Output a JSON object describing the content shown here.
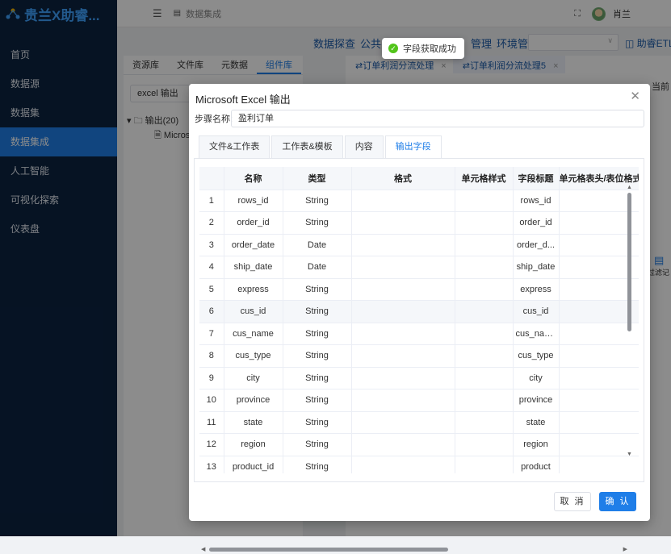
{
  "app": {
    "title": "贵兰X助睿..."
  },
  "sidebar": {
    "items": [
      {
        "label": "首页"
      },
      {
        "label": "数据源"
      },
      {
        "label": "数据集"
      },
      {
        "label": "数据集成",
        "active": true
      },
      {
        "label": "人工智能"
      },
      {
        "label": "可视化探索"
      },
      {
        "label": "仪表盘"
      }
    ]
  },
  "header": {
    "breadcrumb": "数据集成",
    "user": "肖兰"
  },
  "topmenu": {
    "items": [
      "数据探查",
      "公共字",
      "管理",
      "环境管理"
    ],
    "etl": "助睿ETL"
  },
  "left_panel": {
    "tabs": [
      "资源库",
      "文件库",
      "元数据",
      "组件库"
    ],
    "search_value": "excel 输出",
    "tree": {
      "node": "输出(20)",
      "child": "Micros"
    }
  },
  "right_panel": {
    "tabs": [
      "订单利润分流处理",
      "订单利润分流处理5"
    ],
    "side_note": "过滤记",
    "toolbar_label": "当前"
  },
  "toast": {
    "message": "字段获取成功"
  },
  "dialog": {
    "title": "Microsoft Excel 输出",
    "step_label": "步骤名称:",
    "step_value": "盈利订单",
    "tabs": [
      "文件&工作表",
      "工作表&模板",
      "内容",
      "输出字段"
    ],
    "active_tab": 3,
    "columns": [
      "",
      "名称",
      "类型",
      "格式",
      "单元格样式",
      "字段标题",
      "单元格表头/表位格式"
    ],
    "rows": [
      [
        "1",
        "rows_id",
        "String",
        "",
        "",
        "rows_id",
        ""
      ],
      [
        "2",
        "order_id",
        "String",
        "",
        "",
        "order_id",
        ""
      ],
      [
        "3",
        "order_date",
        "Date",
        "",
        "",
        "order_d...",
        ""
      ],
      [
        "4",
        "ship_date",
        "Date",
        "",
        "",
        "ship_date",
        ""
      ],
      [
        "5",
        "express",
        "String",
        "",
        "",
        "express",
        ""
      ],
      [
        "6",
        "cus_id",
        "String",
        "",
        "",
        "cus_id",
        ""
      ],
      [
        "7",
        "cus_name",
        "String",
        "",
        "",
        "cus_name",
        ""
      ],
      [
        "8",
        "cus_type",
        "String",
        "",
        "",
        "cus_type",
        ""
      ],
      [
        "9",
        "city",
        "String",
        "",
        "",
        "city",
        ""
      ],
      [
        "10",
        "province",
        "String",
        "",
        "",
        "province",
        ""
      ],
      [
        "11",
        "state",
        "String",
        "",
        "",
        "state",
        ""
      ],
      [
        "12",
        "region",
        "String",
        "",
        "",
        "region",
        ""
      ],
      [
        "13",
        "product_id",
        "String",
        "",
        "",
        "product",
        ""
      ]
    ],
    "highlight_row": 6,
    "cancel_label": "取 消",
    "ok_label": "确 认"
  },
  "colors": {
    "accent": "#1f7ee8",
    "sidebar_bg": "#0b2341",
    "success": "#52c41a"
  }
}
